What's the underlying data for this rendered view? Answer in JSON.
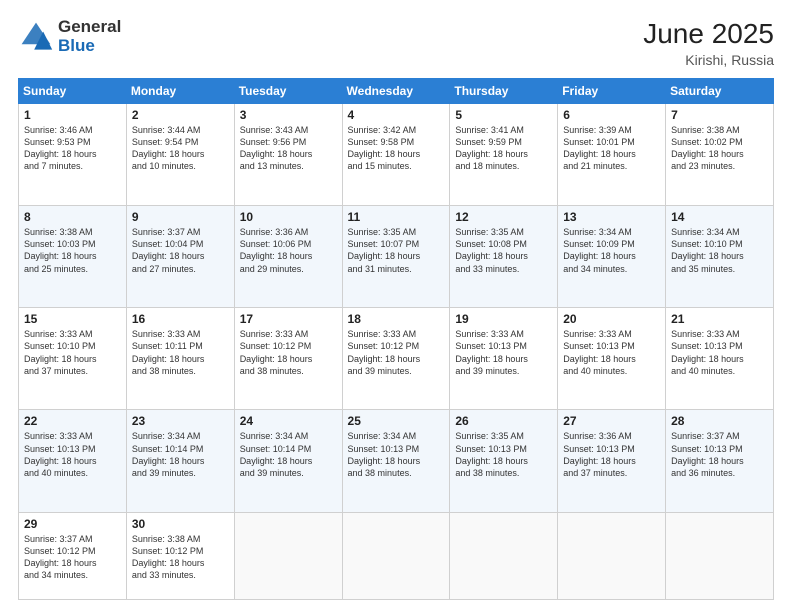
{
  "header": {
    "logo_general": "General",
    "logo_blue": "Blue",
    "month_title": "June 2025",
    "location": "Kirishi, Russia"
  },
  "days_of_week": [
    "Sunday",
    "Monday",
    "Tuesday",
    "Wednesday",
    "Thursday",
    "Friday",
    "Saturday"
  ],
  "weeks": [
    [
      {
        "day": 1,
        "lines": [
          "Sunrise: 3:46 AM",
          "Sunset: 9:53 PM",
          "Daylight: 18 hours",
          "and 7 minutes."
        ]
      },
      {
        "day": 2,
        "lines": [
          "Sunrise: 3:44 AM",
          "Sunset: 9:54 PM",
          "Daylight: 18 hours",
          "and 10 minutes."
        ]
      },
      {
        "day": 3,
        "lines": [
          "Sunrise: 3:43 AM",
          "Sunset: 9:56 PM",
          "Daylight: 18 hours",
          "and 13 minutes."
        ]
      },
      {
        "day": 4,
        "lines": [
          "Sunrise: 3:42 AM",
          "Sunset: 9:58 PM",
          "Daylight: 18 hours",
          "and 15 minutes."
        ]
      },
      {
        "day": 5,
        "lines": [
          "Sunrise: 3:41 AM",
          "Sunset: 9:59 PM",
          "Daylight: 18 hours",
          "and 18 minutes."
        ]
      },
      {
        "day": 6,
        "lines": [
          "Sunrise: 3:39 AM",
          "Sunset: 10:01 PM",
          "Daylight: 18 hours",
          "and 21 minutes."
        ]
      },
      {
        "day": 7,
        "lines": [
          "Sunrise: 3:38 AM",
          "Sunset: 10:02 PM",
          "Daylight: 18 hours",
          "and 23 minutes."
        ]
      }
    ],
    [
      {
        "day": 8,
        "lines": [
          "Sunrise: 3:38 AM",
          "Sunset: 10:03 PM",
          "Daylight: 18 hours",
          "and 25 minutes."
        ]
      },
      {
        "day": 9,
        "lines": [
          "Sunrise: 3:37 AM",
          "Sunset: 10:04 PM",
          "Daylight: 18 hours",
          "and 27 minutes."
        ]
      },
      {
        "day": 10,
        "lines": [
          "Sunrise: 3:36 AM",
          "Sunset: 10:06 PM",
          "Daylight: 18 hours",
          "and 29 minutes."
        ]
      },
      {
        "day": 11,
        "lines": [
          "Sunrise: 3:35 AM",
          "Sunset: 10:07 PM",
          "Daylight: 18 hours",
          "and 31 minutes."
        ]
      },
      {
        "day": 12,
        "lines": [
          "Sunrise: 3:35 AM",
          "Sunset: 10:08 PM",
          "Daylight: 18 hours",
          "and 33 minutes."
        ]
      },
      {
        "day": 13,
        "lines": [
          "Sunrise: 3:34 AM",
          "Sunset: 10:09 PM",
          "Daylight: 18 hours",
          "and 34 minutes."
        ]
      },
      {
        "day": 14,
        "lines": [
          "Sunrise: 3:34 AM",
          "Sunset: 10:10 PM",
          "Daylight: 18 hours",
          "and 35 minutes."
        ]
      }
    ],
    [
      {
        "day": 15,
        "lines": [
          "Sunrise: 3:33 AM",
          "Sunset: 10:10 PM",
          "Daylight: 18 hours",
          "and 37 minutes."
        ]
      },
      {
        "day": 16,
        "lines": [
          "Sunrise: 3:33 AM",
          "Sunset: 10:11 PM",
          "Daylight: 18 hours",
          "and 38 minutes."
        ]
      },
      {
        "day": 17,
        "lines": [
          "Sunrise: 3:33 AM",
          "Sunset: 10:12 PM",
          "Daylight: 18 hours",
          "and 38 minutes."
        ]
      },
      {
        "day": 18,
        "lines": [
          "Sunrise: 3:33 AM",
          "Sunset: 10:12 PM",
          "Daylight: 18 hours",
          "and 39 minutes."
        ]
      },
      {
        "day": 19,
        "lines": [
          "Sunrise: 3:33 AM",
          "Sunset: 10:13 PM",
          "Daylight: 18 hours",
          "and 39 minutes."
        ]
      },
      {
        "day": 20,
        "lines": [
          "Sunrise: 3:33 AM",
          "Sunset: 10:13 PM",
          "Daylight: 18 hours",
          "and 40 minutes."
        ]
      },
      {
        "day": 21,
        "lines": [
          "Sunrise: 3:33 AM",
          "Sunset: 10:13 PM",
          "Daylight: 18 hours",
          "and 40 minutes."
        ]
      }
    ],
    [
      {
        "day": 22,
        "lines": [
          "Sunrise: 3:33 AM",
          "Sunset: 10:13 PM",
          "Daylight: 18 hours",
          "and 40 minutes."
        ]
      },
      {
        "day": 23,
        "lines": [
          "Sunrise: 3:34 AM",
          "Sunset: 10:14 PM",
          "Daylight: 18 hours",
          "and 39 minutes."
        ]
      },
      {
        "day": 24,
        "lines": [
          "Sunrise: 3:34 AM",
          "Sunset: 10:14 PM",
          "Daylight: 18 hours",
          "and 39 minutes."
        ]
      },
      {
        "day": 25,
        "lines": [
          "Sunrise: 3:34 AM",
          "Sunset: 10:13 PM",
          "Daylight: 18 hours",
          "and 38 minutes."
        ]
      },
      {
        "day": 26,
        "lines": [
          "Sunrise: 3:35 AM",
          "Sunset: 10:13 PM",
          "Daylight: 18 hours",
          "and 38 minutes."
        ]
      },
      {
        "day": 27,
        "lines": [
          "Sunrise: 3:36 AM",
          "Sunset: 10:13 PM",
          "Daylight: 18 hours",
          "and 37 minutes."
        ]
      },
      {
        "day": 28,
        "lines": [
          "Sunrise: 3:37 AM",
          "Sunset: 10:13 PM",
          "Daylight: 18 hours",
          "and 36 minutes."
        ]
      }
    ],
    [
      {
        "day": 29,
        "lines": [
          "Sunrise: 3:37 AM",
          "Sunset: 10:12 PM",
          "Daylight: 18 hours",
          "and 34 minutes."
        ]
      },
      {
        "day": 30,
        "lines": [
          "Sunrise: 3:38 AM",
          "Sunset: 10:12 PM",
          "Daylight: 18 hours",
          "and 33 minutes."
        ]
      },
      null,
      null,
      null,
      null,
      null
    ]
  ]
}
